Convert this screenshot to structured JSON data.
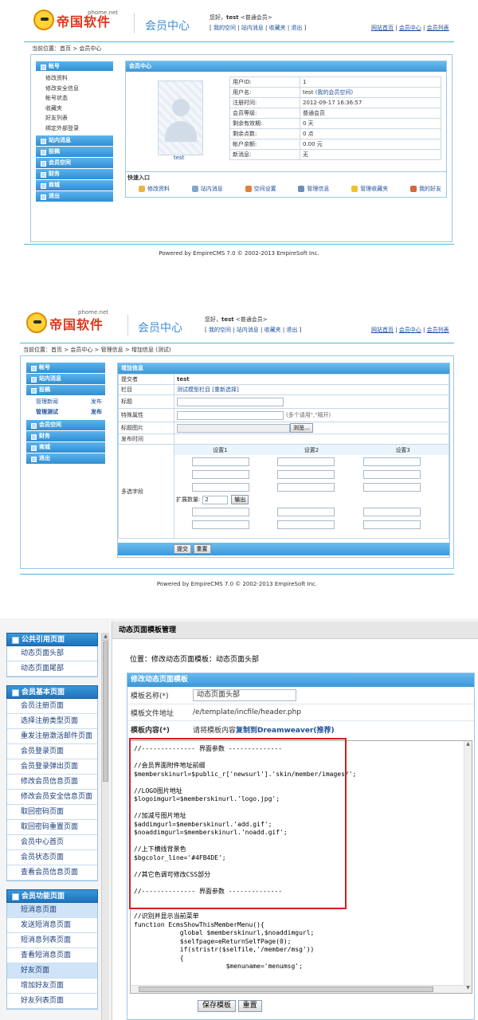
{
  "brand": {
    "domain": "phome.net",
    "name": "帝国软件",
    "section_title": "会员中心"
  },
  "header": {
    "greeting_prefix": "您好，",
    "username": "test",
    "level": "<普通会员>",
    "links": [
      "我的空间",
      "站内消息",
      "收藏夹",
      "退出"
    ],
    "right_links": [
      "网站首页",
      "会员中心",
      "会员列表"
    ]
  },
  "screen1": {
    "breadcrumb": "当前位置：首页 > 会员中心",
    "sidebar": {
      "account_title": "帐号",
      "account_items": [
        "修改资料",
        "修改安全信息",
        "帐号状态",
        "收藏夹",
        "好友列表",
        "绑定外部登录"
      ],
      "groups": [
        "站内消息",
        "投稿",
        "会员空间",
        "财务",
        "商城",
        "退出"
      ]
    },
    "panel_title": "会员中心",
    "avatar_caption": "test",
    "info": [
      {
        "label": "用户ID:",
        "value": "1"
      },
      {
        "label": "用户名:",
        "value": "test",
        "link": "(我的会员空间)"
      },
      {
        "label": "注册时间:",
        "value": "2012-09-17 16:36:57"
      },
      {
        "label": "会员等级:",
        "value": "普通会员"
      },
      {
        "label": "剩余有效期:",
        "value": "0 天"
      },
      {
        "label": "剩余点数:",
        "value": "0 点"
      },
      {
        "label": "帐户余额:",
        "value": "0.00 元"
      },
      {
        "label": "新消息:",
        "value": "无"
      }
    ],
    "quick_title": "快速入口",
    "quick_links": [
      "修改资料",
      "站内消息",
      "空间设置",
      "管理信息",
      "管理收藏夹",
      "我的好友"
    ],
    "footer": "Powered by EmpireCMS 7.0 © 2002-2013 EmpireSoft Inc."
  },
  "screen2": {
    "breadcrumb": "当前位置：首页 > 会员中心 > 管理信息 > 增加信息 (测试)",
    "sidebar_groups_top": [
      "帐号",
      "站内消息",
      "投稿"
    ],
    "sub_items": [
      {
        "name": "管理新闻",
        "action": "发布"
      },
      {
        "name": "管理测试",
        "action": "发布"
      }
    ],
    "sidebar_groups_bottom": [
      "会员空间",
      "财务",
      "商城",
      "退出"
    ],
    "form_title": "增加信息",
    "submitter_label": "提交者",
    "submitter_value": "test",
    "column_label": "栏目",
    "column_value": "测试模型栏目 [重新选择]",
    "title_label": "标题",
    "attr_label": "特殊属性",
    "attr_hint": "(多个请用\",\"隔开)",
    "image_label": "标题图片",
    "browse_button": "浏览...",
    "time_label": "发布时间",
    "multi_label": "多选字段",
    "setting_headers": [
      "设置1",
      "设置2",
      "设置3"
    ],
    "expand_label": "扩展数量:",
    "expand_value": "2",
    "output_button": "输出",
    "submit_button": "提交",
    "reset_button": "重置",
    "footer": "Powered by EmpireCMS 7.0 © 2002-2013 EmpireSoft Inc."
  },
  "screen3": {
    "sidebar": [
      {
        "title": "公共引用页面",
        "items": [
          "动态页面头部",
          "动态页面尾部"
        ]
      },
      {
        "title": "会员基本页面",
        "items": [
          "会员注册页面",
          "选择注册类型页面",
          "重发注册激活邮件页面",
          "会员登录页面",
          "会员登录弹出页面",
          "修改会员信息页面",
          "修改会员安全信息页面",
          "取回密码页面",
          "取回密码重置页面",
          "会员中心首页",
          "会员状态页面",
          "查看会员信息页面"
        ]
      },
      {
        "title": "会员功能页面",
        "items": [
          "短消息页面",
          "发送短消息页面",
          "短消息列表页面",
          "查看短消息页面",
          "好友页面",
          "增加好友页面",
          "好友列表页面"
        ]
      }
    ],
    "selected_items": [
      "短消息页面",
      "好友页面"
    ],
    "page_title": "动态页面模板管理",
    "location": "位置：修改动态页面模板：动态页面头部",
    "form_title": "修改动态页面模板",
    "name_label": "模板名称(*)",
    "name_value": "动态页面头部",
    "file_label": "模板文件地址",
    "file_value": "/e/template/incfile/header.php",
    "content_label": "模板内容(*)",
    "content_hint": "请将模板内容",
    "content_link": "复制到Dreamweaver(推荐)",
    "code_lines": [
      "//-------------- 界面参数 --------------",
      "",
      "//会员界面附件地址前缀",
      "$memberskinurl=$public_r['newsurl'].'skin/member/images/';",
      "",
      "//LOGO图片地址",
      "$logoimgurl=$memberskinurl.'logo.jpg';",
      "",
      "//加减号图片地址",
      "$addimgurl=$memberskinurl.'add.gif';",
      "$noaddimgurl=$memberskinurl.'noadd.gif';",
      "",
      "//上下横线背景色",
      "$bgcolor_line='#4FB4DE';",
      "",
      "//其它色调可修改CSS部分",
      "",
      "//-------------- 界面参数 --------------",
      "",
      "",
      "//识别并显示当前菜单",
      "function EcmsShowThisMemberMenu(){",
      "            global $memberskinurl,$noaddimgurl;",
      "            $selfpage=eReturnSelfPage(0);",
      "            if(stristr($selfile,'/member/msg'))",
      "            {",
      "                        $menuname='menumsg';"
    ],
    "save_button": "保存模板",
    "reset_button": "重置"
  },
  "colors": {
    "accent": "#3d97d8",
    "brand_red": "#e0351c",
    "highlight_border": "#d21f1f"
  }
}
